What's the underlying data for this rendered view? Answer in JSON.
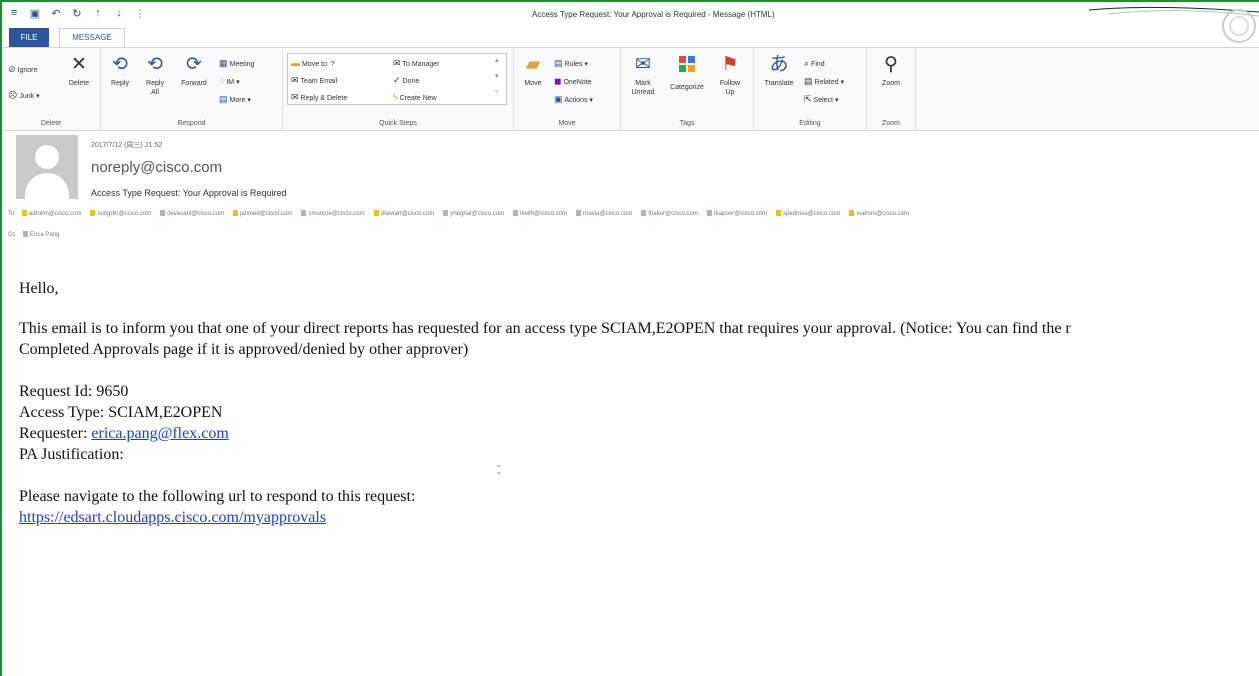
{
  "window": {
    "title": "Access Type Request: Your Approval is Required - Message (HTML)"
  },
  "tabs": {
    "file": "FILE",
    "message": "MESSAGE"
  },
  "ribbon": {
    "delete_group": {
      "label": "Delete",
      "ignore": "Ignore",
      "junk": "Junk ▾",
      "delete": "Delete"
    },
    "respond_group": {
      "label": "Respond",
      "reply": "Reply",
      "reply_all": "Reply All",
      "forward": "Forward",
      "meeting": "Meeting",
      "im": "IM ▾",
      "more": "More ▾"
    },
    "quicksteps_group": {
      "label": "Quick Steps",
      "move_to": "Move to: ?",
      "team_email": "Team Email",
      "reply_delete": "Reply & Delete",
      "to_manager": "To Manager",
      "done": "Done",
      "create_new": "Create New"
    },
    "move_group": {
      "label": "Move",
      "move": "Move",
      "rules": "Rules ▾",
      "onenote": "OneNote",
      "actions": "Actions ▾"
    },
    "tags_group": {
      "label": "Tags",
      "mark_unread": "Mark Unread",
      "categorize": "Categorize",
      "follow_up": "Follow Up"
    },
    "editing_group": {
      "label": "Editing",
      "translate": "Translate",
      "find": "Find",
      "related": "Related ▾",
      "select": "Select ▾"
    },
    "zoom_group": {
      "label": "Zoom",
      "zoom": "Zoom"
    }
  },
  "header": {
    "date": "2017/7/12 (周三) 21:52",
    "sender": "noreply@cisco.com",
    "subject": "Access Type Request: Your Approval is Required",
    "to_label": "To",
    "to": [
      {
        "name": "adrollm@cisco.com",
        "color": "#e8c21a"
      },
      {
        "name": "sungdin@cisco.com",
        "color": "#e8c21a"
      },
      {
        "name": "devasani@cisco.com",
        "color": "#a9b6c8"
      },
      {
        "name": "jahmed@cisco.com",
        "color": "#e8c21a"
      },
      {
        "name": "cmonroe@cisco.com",
        "color": "#a9b6c8"
      },
      {
        "name": "dsewart@cisco.com",
        "color": "#e8c21a"
      },
      {
        "name": "jmeghal@cisco.com",
        "color": "#a9b6c8"
      },
      {
        "name": "lkeith@cisco.com",
        "color": "#a9b6c8"
      },
      {
        "name": "roseta@cisco.com",
        "color": "#a9b6c8"
      },
      {
        "name": "thakur@cisco.com",
        "color": "#a9b6c8"
      },
      {
        "name": "rkapoor@cisco.com",
        "color": "#a9b6c8"
      },
      {
        "name": "spedrosa@cisco.com",
        "color": "#e8c21a"
      },
      {
        "name": "vuehiro@cisco.com",
        "color": "#e8c21a"
      }
    ],
    "cc_label": "Cc",
    "cc": [
      {
        "name": "Erica Pang",
        "color": "#a9b6c8"
      }
    ]
  },
  "body": {
    "greeting": "Hello,",
    "para1_line1": "This email is to inform you that one of your direct reports has requested for an access type SCIAM,E2OPEN that requires your approval. (Notice: You can find the r",
    "para1_line2": "Completed Approvals page if it is approved/denied by other approver)",
    "request_id": "Request Id: 9650",
    "access_type": "Access Type: SCIAM,E2OPEN",
    "requester_label": "Requester: ",
    "requester_email": "erica.pang@flex.com",
    "pa_justification": "PA Justification:",
    "navigate": "Please navigate to the following url to respond to this request:",
    "url": "https://edsart.cloudapps.cisco.com/myapprovals"
  },
  "colors": {
    "accent": "#2b579a",
    "link": "#1a3fd1",
    "frame": "#1a8f3a"
  }
}
